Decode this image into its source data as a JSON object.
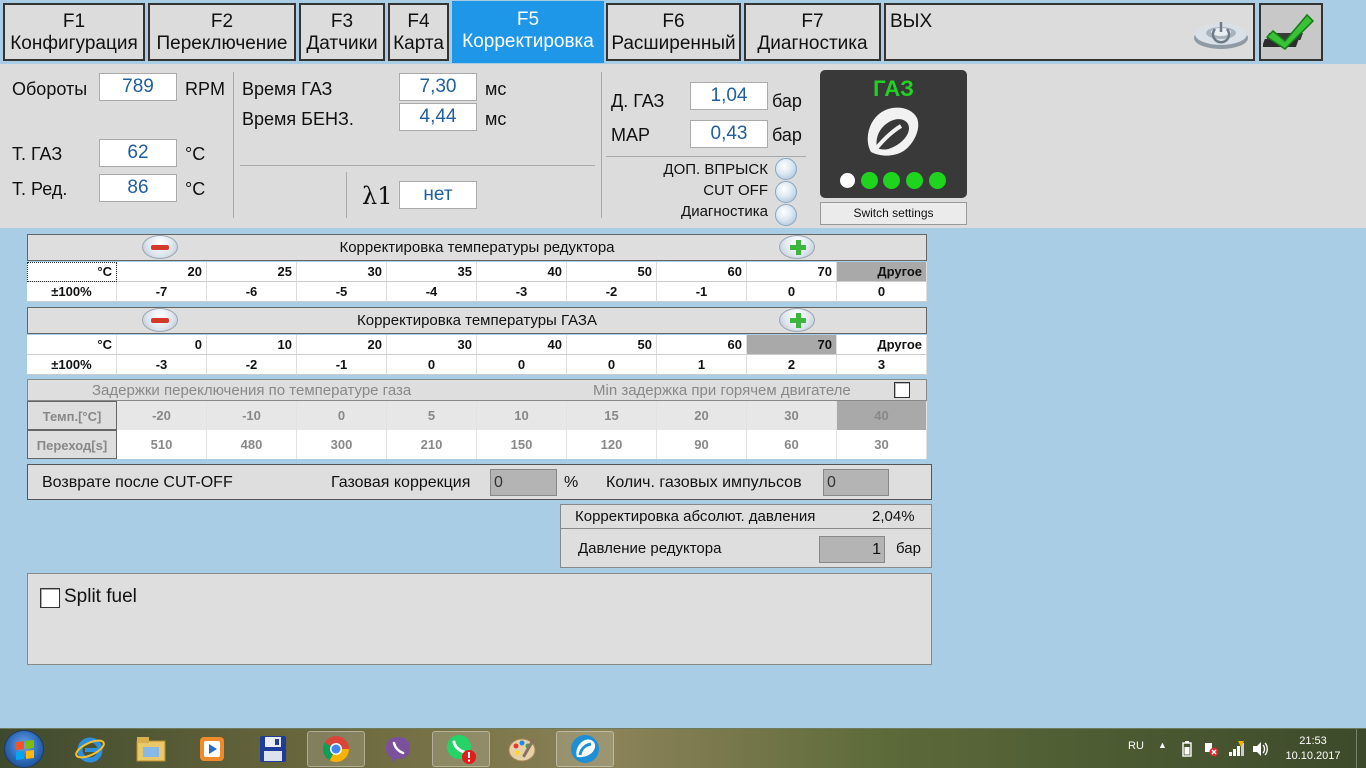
{
  "tabs": [
    {
      "key": "F1",
      "label": "Конфигурация"
    },
    {
      "key": "F2",
      "label": "Переключение"
    },
    {
      "key": "F3",
      "label": "Датчики"
    },
    {
      "key": "F4",
      "label": "Карта"
    },
    {
      "key": "F5",
      "label": "Корректировка"
    },
    {
      "key": "F6",
      "label": "Расширенный"
    },
    {
      "key": "F7",
      "label": "Диагностика"
    }
  ],
  "active_tab": "F5",
  "exit_label": "ВЫХ",
  "readings": {
    "rpm_label": "Обороты",
    "rpm_value": "789",
    "rpm_unit": "RPM",
    "tgas_label": "Т. ГАЗ",
    "tgas_value": "62",
    "tgas_unit": "°C",
    "tred_label": "Т. Ред.",
    "tred_value": "86",
    "tred_unit": "°C",
    "gas_time_label": "Время ГАЗ",
    "gas_time_value": "7,30",
    "gas_time_unit": "мс",
    "petrol_time_label": "Время БЕНЗ.",
    "petrol_time_value": "4,44",
    "petrol_time_unit": "мс",
    "lambda_label": "λ1",
    "lambda_value": "нет",
    "dgas_label": "Д. ГАЗ",
    "dgas_value": "1,04",
    "dgas_unit": "бар",
    "map_label": "MAP",
    "map_value": "0,43",
    "map_unit": "бар"
  },
  "indicators": [
    {
      "label": "ДОП. ВПРЫСК"
    },
    {
      "label": "CUT OFF"
    },
    {
      "label": "Диагностика"
    }
  ],
  "gas_panel": {
    "title": "ГАЗ",
    "switch_label": "Switch settings",
    "accent": "#21d321"
  },
  "reducer_table": {
    "title": "Корректировка температуры редуктора",
    "header": [
      "°C",
      "20",
      "25",
      "30",
      "35",
      "40",
      "50",
      "60",
      "70",
      "Другое"
    ],
    "values": [
      "±100%",
      "-7",
      "-6",
      "-5",
      "-4",
      "-3",
      "-2",
      "-1",
      "0",
      "0"
    ]
  },
  "gas_table": {
    "title": "Корректировка температуры ГАЗА",
    "header": [
      "°C",
      "0",
      "10",
      "20",
      "30",
      "40",
      "50",
      "60",
      "70",
      "Другое"
    ],
    "values": [
      "±100%",
      "-3",
      "-2",
      "-1",
      "0",
      "0",
      "0",
      "1",
      "2",
      "3"
    ]
  },
  "delay_table": {
    "title": "Задержки переключения по температуре газа",
    "hot_engine_label": "Min задержка при горячем двигателе",
    "temp_row": [
      "Темп.[°C]",
      "-20",
      "-10",
      "0",
      "5",
      "10",
      "15",
      "20",
      "30",
      "40"
    ],
    "transition_row": [
      "Переход[s]",
      "510",
      "480",
      "300",
      "210",
      "150",
      "120",
      "90",
      "60",
      "30"
    ]
  },
  "cutoff": {
    "return_label": "Возврате после CUT-OFF",
    "gas_corr_label": "Газовая коррекция",
    "gas_corr_value": "0",
    "gas_corr_unit": "%",
    "pulses_label": "Колич. газовых импульсов",
    "pulses_value": "0"
  },
  "pressure": {
    "abs_label": "Корректировка абсолют. давления",
    "abs_value": "2,04%",
    "reducer_label": "Давление редуктора",
    "reducer_value": "1",
    "reducer_unit": "бар"
  },
  "split_fuel": {
    "label": "Split fuel"
  },
  "taskbar": {
    "apps": [
      "internet-explorer",
      "file-explorer",
      "media-player",
      "save-disk",
      "chrome",
      "viber",
      "whatsapp",
      "paint",
      "gas-software"
    ],
    "lang": "RU",
    "time": "21:53",
    "date": "10.10.2017"
  }
}
